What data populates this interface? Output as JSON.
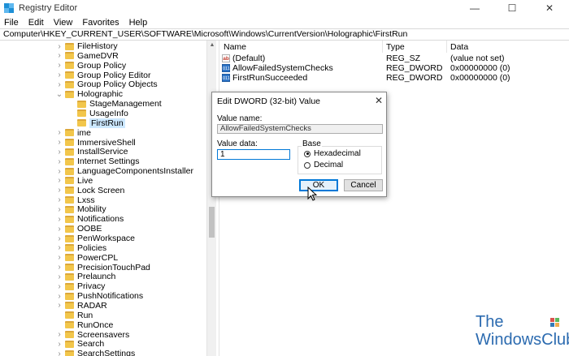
{
  "window": {
    "title": "Registry Editor",
    "minimize_glyph": "—",
    "maximize_glyph": "☐",
    "close_glyph": "✕"
  },
  "menu": [
    "File",
    "Edit",
    "View",
    "Favorites",
    "Help"
  ],
  "address": "Computer\\HKEY_CURRENT_USER\\SOFTWARE\\Microsoft\\Windows\\CurrentVersion\\Holographic\\FirstRun",
  "tree": {
    "items": [
      {
        "label": "FileHistory",
        "expandable": true
      },
      {
        "label": "GameDVR",
        "expandable": true
      },
      {
        "label": "Group Policy",
        "expandable": true
      },
      {
        "label": "Group Policy Editor",
        "expandable": true
      },
      {
        "label": "Group Policy Objects",
        "expandable": true
      },
      {
        "label": "Holographic",
        "expanded": true
      },
      {
        "label": "StageManagement",
        "child": true
      },
      {
        "label": "UsageInfo",
        "child": true
      },
      {
        "label": "FirstRun",
        "child": true,
        "selected": true
      },
      {
        "label": "ime",
        "expandable": true
      },
      {
        "label": "ImmersiveShell",
        "expandable": true
      },
      {
        "label": "InstallService",
        "expandable": true
      },
      {
        "label": "Internet Settings",
        "expandable": true
      },
      {
        "label": "LanguageComponentsInstaller",
        "expandable": true
      },
      {
        "label": "Live",
        "expandable": true
      },
      {
        "label": "Lock Screen",
        "expandable": true
      },
      {
        "label": "Lxss",
        "expandable": true
      },
      {
        "label": "Mobility",
        "expandable": true
      },
      {
        "label": "Notifications",
        "expandable": true
      },
      {
        "label": "OOBE",
        "expandable": true
      },
      {
        "label": "PenWorkspace",
        "expandable": true
      },
      {
        "label": "Policies",
        "expandable": true
      },
      {
        "label": "PowerCPL",
        "expandable": true
      },
      {
        "label": "PrecisionTouchPad",
        "expandable": true
      },
      {
        "label": "Prelaunch",
        "expandable": true
      },
      {
        "label": "Privacy",
        "expandable": true
      },
      {
        "label": "PushNotifications",
        "expandable": true
      },
      {
        "label": "RADAR",
        "expandable": true
      },
      {
        "label": "Run",
        "expandable": false
      },
      {
        "label": "RunOnce",
        "expandable": false
      },
      {
        "label": "Screensavers",
        "expandable": true
      },
      {
        "label": "Search",
        "expandable": true
      },
      {
        "label": "SearchSettings",
        "expandable": true
      }
    ]
  },
  "list": {
    "headers": {
      "name": "Name",
      "type": "Type",
      "data": "Data"
    },
    "rows": [
      {
        "icon": "string-value-icon",
        "icon_text": "ab",
        "name": "(Default)",
        "type": "REG_SZ",
        "data": "(value not set)"
      },
      {
        "icon": "dword-value-icon",
        "icon_text": "011",
        "name": "AllowFailedSystemChecks",
        "type": "REG_DWORD",
        "data": "0x00000000 (0)"
      },
      {
        "icon": "dword-value-icon",
        "icon_text": "011",
        "name": "FirstRunSucceeded",
        "type": "REG_DWORD",
        "data": "0x00000000 (0)"
      }
    ]
  },
  "dialog": {
    "title": "Edit DWORD (32-bit) Value",
    "close_glyph": "✕",
    "value_name_label": "Value name:",
    "value_name": "AllowFailedSystemChecks",
    "value_data_label": "Value data:",
    "value_data": "1",
    "base_label": "Base",
    "hex_label": "Hexadecimal",
    "dec_label": "Decimal",
    "base_selected": "Hexadecimal",
    "ok_label": "OK",
    "cancel_label": "Cancel"
  },
  "watermark": {
    "line1": "The",
    "line2": "WindowsClub"
  },
  "colors": {
    "selection": "#cce8ff",
    "accent": "#0078d7",
    "watermark": "#2c6bb0"
  }
}
